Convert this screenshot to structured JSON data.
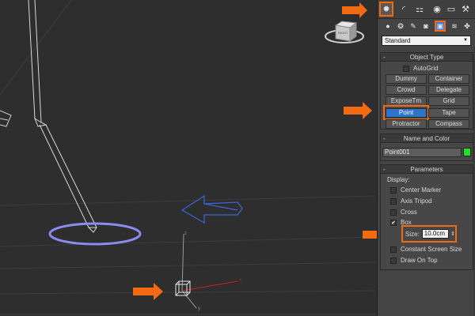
{
  "viewport": {
    "gizmo_label": "RIGHT",
    "axis_x_label": "x",
    "axis_y_label": "y",
    "axis_z_label": "z"
  },
  "command_panel": {
    "tabs": [
      {
        "id": "create",
        "icon": "sun-create-icon",
        "glyph": "✹",
        "active": true
      },
      {
        "id": "modify",
        "icon": "bend-modify-icon",
        "glyph": "◜",
        "active": false
      },
      {
        "id": "hierarchy",
        "icon": "hierarchy-icon",
        "glyph": "⚏",
        "active": false
      },
      {
        "id": "motion",
        "icon": "motion-icon",
        "glyph": "◉",
        "active": false
      },
      {
        "id": "display",
        "icon": "display-icon",
        "glyph": "▭",
        "active": false
      },
      {
        "id": "utilities",
        "icon": "hammer-icon",
        "glyph": "⚒",
        "active": false
      }
    ],
    "subtabs": [
      {
        "id": "geometry",
        "icon": "sphere-icon",
        "glyph": "●",
        "active": false
      },
      {
        "id": "shapes",
        "icon": "shapes-icon",
        "glyph": "❂",
        "active": false
      },
      {
        "id": "lights",
        "icon": "light-icon",
        "glyph": "✎",
        "active": false
      },
      {
        "id": "cameras",
        "icon": "camera-icon",
        "glyph": "◙",
        "active": false
      },
      {
        "id": "helpers",
        "icon": "helpers-icon",
        "glyph": "▣",
        "active": true
      },
      {
        "id": "spacewarps",
        "icon": "spacewarp-icon",
        "glyph": "≋",
        "active": false
      },
      {
        "id": "systems",
        "icon": "systems-icon",
        "glyph": "✤",
        "active": false
      }
    ],
    "category_dropdown": "Standard",
    "object_type": {
      "title": "Object Type",
      "minus": "-",
      "autogrid_label": "AutoGrid",
      "buttons": {
        "dummy": "Dummy",
        "container": "Container",
        "crowd": "Crowd",
        "delegate": "Delegate",
        "exposetm": "ExposeTm",
        "grid": "Grid",
        "point": "Point",
        "tape": "Tape",
        "protractor": "Protractor",
        "compass": "Compass"
      },
      "active_button": "Point"
    },
    "name_and_color": {
      "title": "Name and Color",
      "minus": "-",
      "name_value": "Point001",
      "color": "#22e02a"
    },
    "parameters": {
      "title": "Parameters",
      "minus": "-",
      "display_label": "Display:",
      "center_marker": {
        "label": "Center Marker",
        "checked": false
      },
      "axis_tripod": {
        "label": "Axis Tripod",
        "checked": false
      },
      "cross": {
        "label": "Cross",
        "checked": false
      },
      "box": {
        "label": "Box",
        "checked": true,
        "mark": "✔"
      },
      "size_label": "Size:",
      "size_value": "10.0cm",
      "constant_screen_size": {
        "label": "Constant Screen Size",
        "checked": false
      },
      "draw_on_top": {
        "label": "Draw On Top",
        "checked": false
      }
    }
  },
  "colors": {
    "highlight": "#f26a12",
    "active_blue": "#2f74c9",
    "ring": "#8c8cf0"
  }
}
